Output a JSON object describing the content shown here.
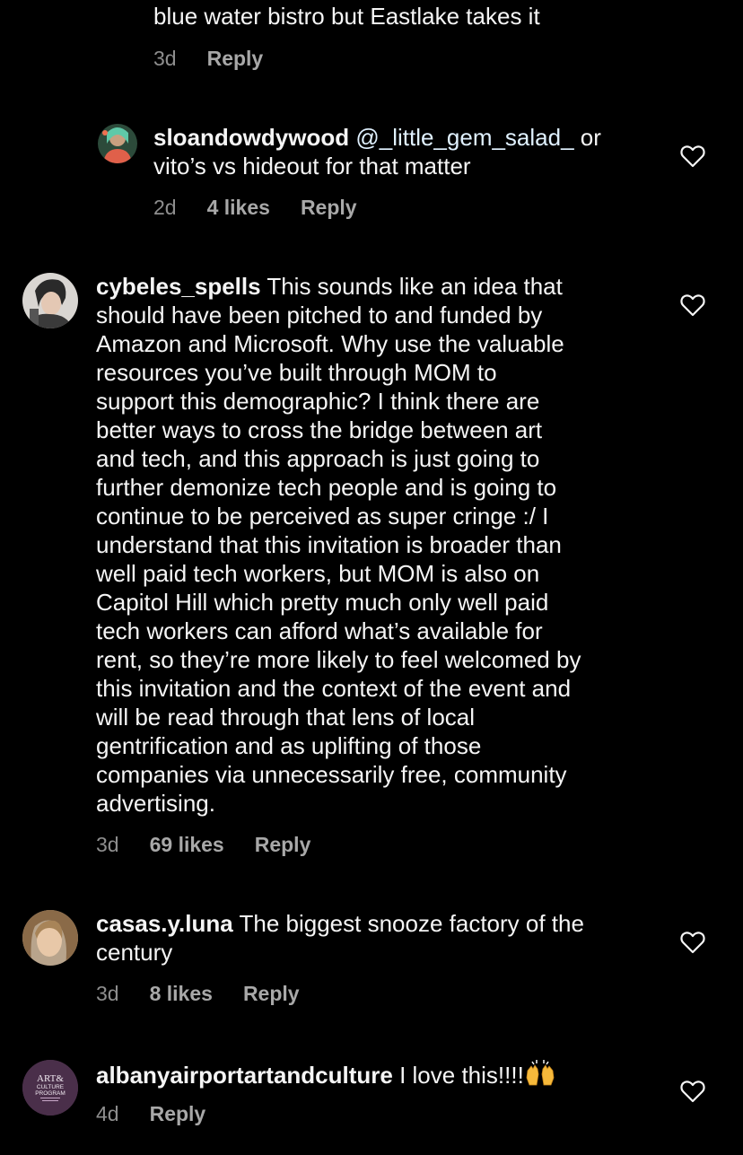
{
  "colors": {
    "background": "#000000",
    "text": "#f5f5f5",
    "meta": "#a8a8a8",
    "mention": "#e0f1ff"
  },
  "comments": [
    {
      "text": "blue water bistro but Eastlake takes it",
      "time": "3d",
      "reply": "Reply"
    },
    {
      "username": "sloandowdywood",
      "mention": "@_little_gem_salad_",
      "text_after_mention": " or\nvito’s vs hideout for that matter",
      "time": "2d",
      "likes": "4 likes",
      "reply": "Reply",
      "icon": "heart-outline-icon"
    },
    {
      "username": "cybeles_spells",
      "text": " This sounds like an idea that\nshould have been pitched to and funded by\nAmazon and Microsoft. Why use the valuable\nresources you’ve built through MOM to\nsupport this demographic? I think there are\nbetter ways to cross the bridge between art\nand tech, and this approach is just going to\nfurther demonize tech people and is going to\ncontinue to be perceived as super cringe :/ I\nunderstand that this invitation is broader than\nwell paid tech workers, but MOM is also on\nCapitol Hill which pretty much only well paid\ntech workers can afford what’s available for\nrent, so they’re more likely to feel welcomed by\nthis invitation and the context of the event and\nwill be read through that lens of local\ngentrification and as uplifting of those\ncompanies via unnecessarily free, community\nadvertising.",
      "time": "3d",
      "likes": "69 likes",
      "reply": "Reply",
      "icon": "heart-outline-icon"
    },
    {
      "username": "casas.y.luna",
      "text": " The biggest snooze factory of the\ncentury",
      "time": "3d",
      "likes": "8 likes",
      "reply": "Reply",
      "icon": "heart-outline-icon"
    },
    {
      "username": "albanyairportartandculture",
      "text": " I love this!!!!",
      "emoji": "raising-hands-emoji",
      "time": "4d",
      "reply": "Reply",
      "icon": "heart-outline-icon",
      "avatar_logo": {
        "line1": "ART&",
        "line2": "CULTURE",
        "line3": "PROGRAM"
      }
    }
  ]
}
